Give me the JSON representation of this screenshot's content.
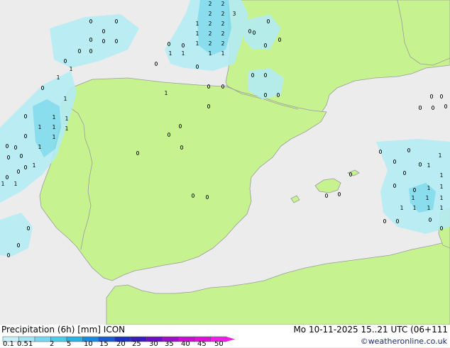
{
  "legend": {
    "title": "Precipitation (6h) [mm] ICON",
    "datetime": "Mo 10-11-2025 15..21 UTC (06+111",
    "credit": "©weatheronline.co.uk",
    "scale_labels": [
      "0.1",
      "0.5",
      "1",
      "2",
      "5",
      "10",
      "15",
      "20",
      "25",
      "30",
      "35",
      "40",
      "45",
      "50"
    ],
    "scale_colors": [
      "#c8f0f8",
      "#a0e4f4",
      "#78d6ee",
      "#50c8e8",
      "#2eb0e0",
      "#1e88d8",
      "#1a5cd0",
      "#1e30c4",
      "#3a1cb8",
      "#6a10c0",
      "#9a10c8",
      "#c810c8",
      "#e010d0",
      "#f020e0"
    ]
  },
  "colors": {
    "sea": "#ececec",
    "land": "#c6f38f",
    "border": "#9b9b9b",
    "precip_light": "#b4ecf4",
    "precip_medium": "#7fdcee"
  },
  "map_labels": {
    "north_group": [
      "2",
      "2",
      "2",
      "2",
      "3",
      "1",
      "2",
      "2",
      "1",
      "2",
      "2",
      "1",
      "2",
      "2",
      "1",
      "1",
      "1",
      "1",
      "1",
      "1",
      "1",
      "1"
    ],
    "west_group": [
      "1",
      "1",
      "1",
      "1",
      "1",
      "1",
      "1",
      "1",
      "1",
      "1"
    ],
    "east_group": [
      "1",
      "1",
      "1",
      "1",
      "1",
      "1",
      "1",
      "1",
      "1",
      "1",
      "1",
      "1"
    ]
  }
}
